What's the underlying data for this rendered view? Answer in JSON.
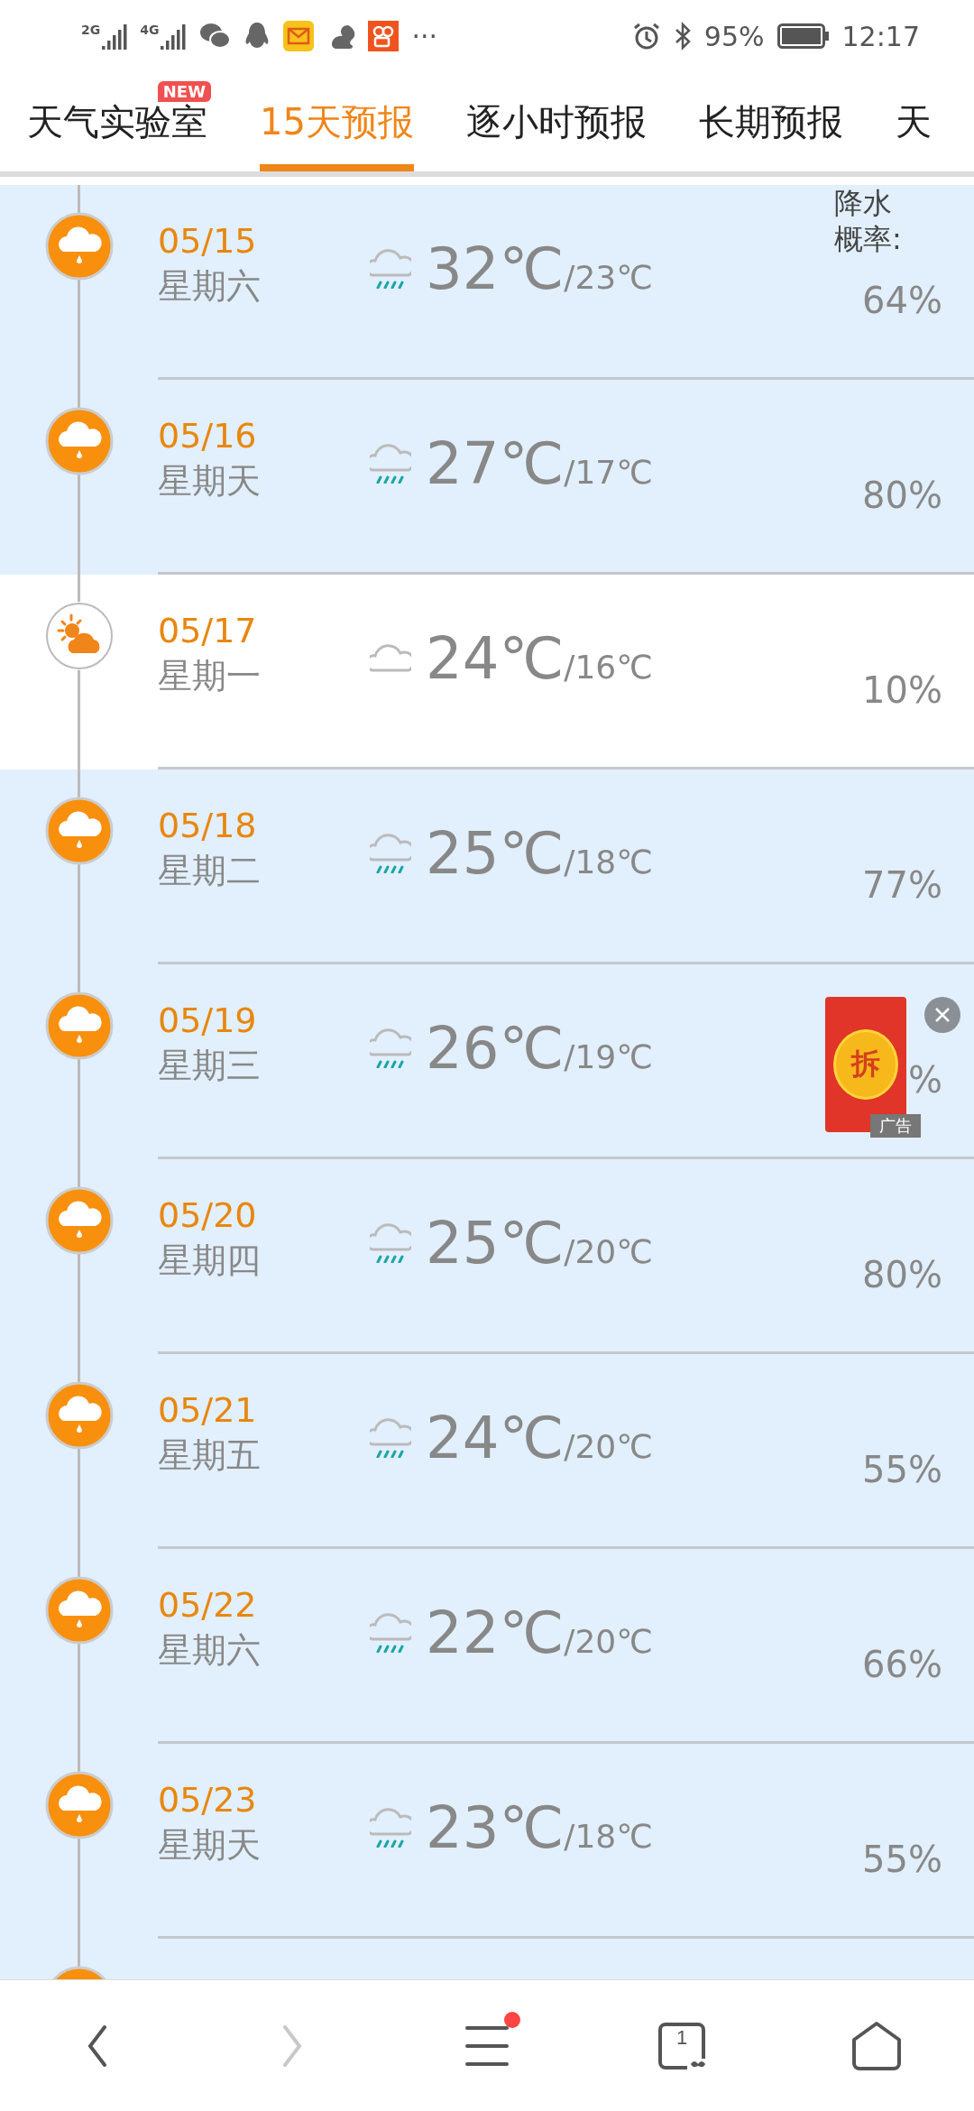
{
  "status_bar": {
    "networks": [
      "2G",
      "4G"
    ],
    "more": "···",
    "battery": "95%",
    "time": "12:17"
  },
  "tabs": [
    {
      "label": "天气实验室",
      "badge": "NEW",
      "selected": false
    },
    {
      "label": "15天预报",
      "selected": true
    },
    {
      "label": "逐小时预报",
      "selected": false
    },
    {
      "label": "长期预报",
      "selected": false
    },
    {
      "label": "天",
      "selected": false
    }
  ],
  "precip_header": "降水概率:",
  "days": [
    {
      "date": "05/15",
      "weekday": "星期六",
      "kind": "rain",
      "current": false,
      "high": "32℃",
      "low": "/23℃",
      "precip": "64%"
    },
    {
      "date": "05/16",
      "weekday": "星期天",
      "kind": "rain",
      "current": false,
      "high": "27℃",
      "low": "/17℃",
      "precip": "80%"
    },
    {
      "date": "05/17",
      "weekday": "星期一",
      "kind": "cloudy",
      "current": true,
      "high": "24℃",
      "low": "/16℃",
      "precip": "10%"
    },
    {
      "date": "05/18",
      "weekday": "星期二",
      "kind": "rain",
      "current": false,
      "high": "25℃",
      "low": "/18℃",
      "precip": "77%"
    },
    {
      "date": "05/19",
      "weekday": "星期三",
      "kind": "rain",
      "current": false,
      "high": "26℃",
      "low": "/19℃",
      "precip": "%",
      "ad": {
        "seal": "拆",
        "label": "广告"
      }
    },
    {
      "date": "05/20",
      "weekday": "星期四",
      "kind": "rain",
      "current": false,
      "high": "25℃",
      "low": "/20℃",
      "precip": "80%"
    },
    {
      "date": "05/21",
      "weekday": "星期五",
      "kind": "rain",
      "current": false,
      "high": "24℃",
      "low": "/20℃",
      "precip": "55%"
    },
    {
      "date": "05/22",
      "weekday": "星期六",
      "kind": "rain",
      "current": false,
      "high": "22℃",
      "low": "/20℃",
      "precip": "66%"
    },
    {
      "date": "05/23",
      "weekday": "星期天",
      "kind": "rain",
      "current": false,
      "high": "23℃",
      "low": "/18℃",
      "precip": "55%"
    }
  ],
  "bottom_nav": [
    {
      "kind": "back",
      "disabled": false
    },
    {
      "kind": "forward",
      "disabled": true
    },
    {
      "kind": "menu",
      "disabled": false,
      "dot": true
    },
    {
      "kind": "tabs",
      "disabled": false,
      "count": "1"
    },
    {
      "kind": "home",
      "disabled": false
    }
  ]
}
